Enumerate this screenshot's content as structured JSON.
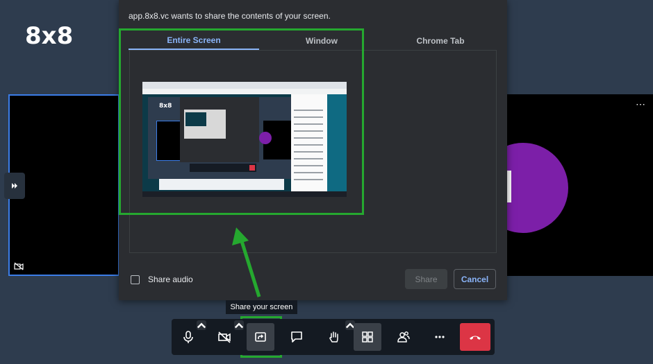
{
  "brand": {
    "logo_text": "8x8"
  },
  "dialog": {
    "title": "app.8x8.vc wants to share the contents of your screen.",
    "tabs": [
      {
        "label": "Entire Screen",
        "active": true
      },
      {
        "label": "Window",
        "active": false
      },
      {
        "label": "Chrome Tab",
        "active": false
      }
    ],
    "share_audio_label": "Share audio",
    "share_audio_checked": false,
    "share_button": "Share",
    "cancel_button": "Cancel"
  },
  "tooltip": {
    "text": "Share your screen"
  },
  "toolbar": {
    "buttons": [
      {
        "name": "microphone",
        "icon": "microphone-icon"
      },
      {
        "name": "camera",
        "icon": "camera-off-icon"
      },
      {
        "name": "share-screen",
        "icon": "share-screen-icon",
        "selected": true
      },
      {
        "name": "chat",
        "icon": "chat-icon"
      },
      {
        "name": "raise-hand",
        "icon": "hand-icon"
      },
      {
        "name": "tile-view",
        "icon": "grid-icon"
      },
      {
        "name": "participants",
        "icon": "participants-icon"
      },
      {
        "name": "more",
        "icon": "more-dots-icon"
      },
      {
        "name": "leave",
        "icon": "hangup-icon"
      }
    ]
  },
  "colors": {
    "background": "#2e3c4e",
    "accent": "#8ab4f8",
    "highlight": "#25a82f",
    "hangup": "#dc3545",
    "avatar": "#7c1fa8"
  }
}
